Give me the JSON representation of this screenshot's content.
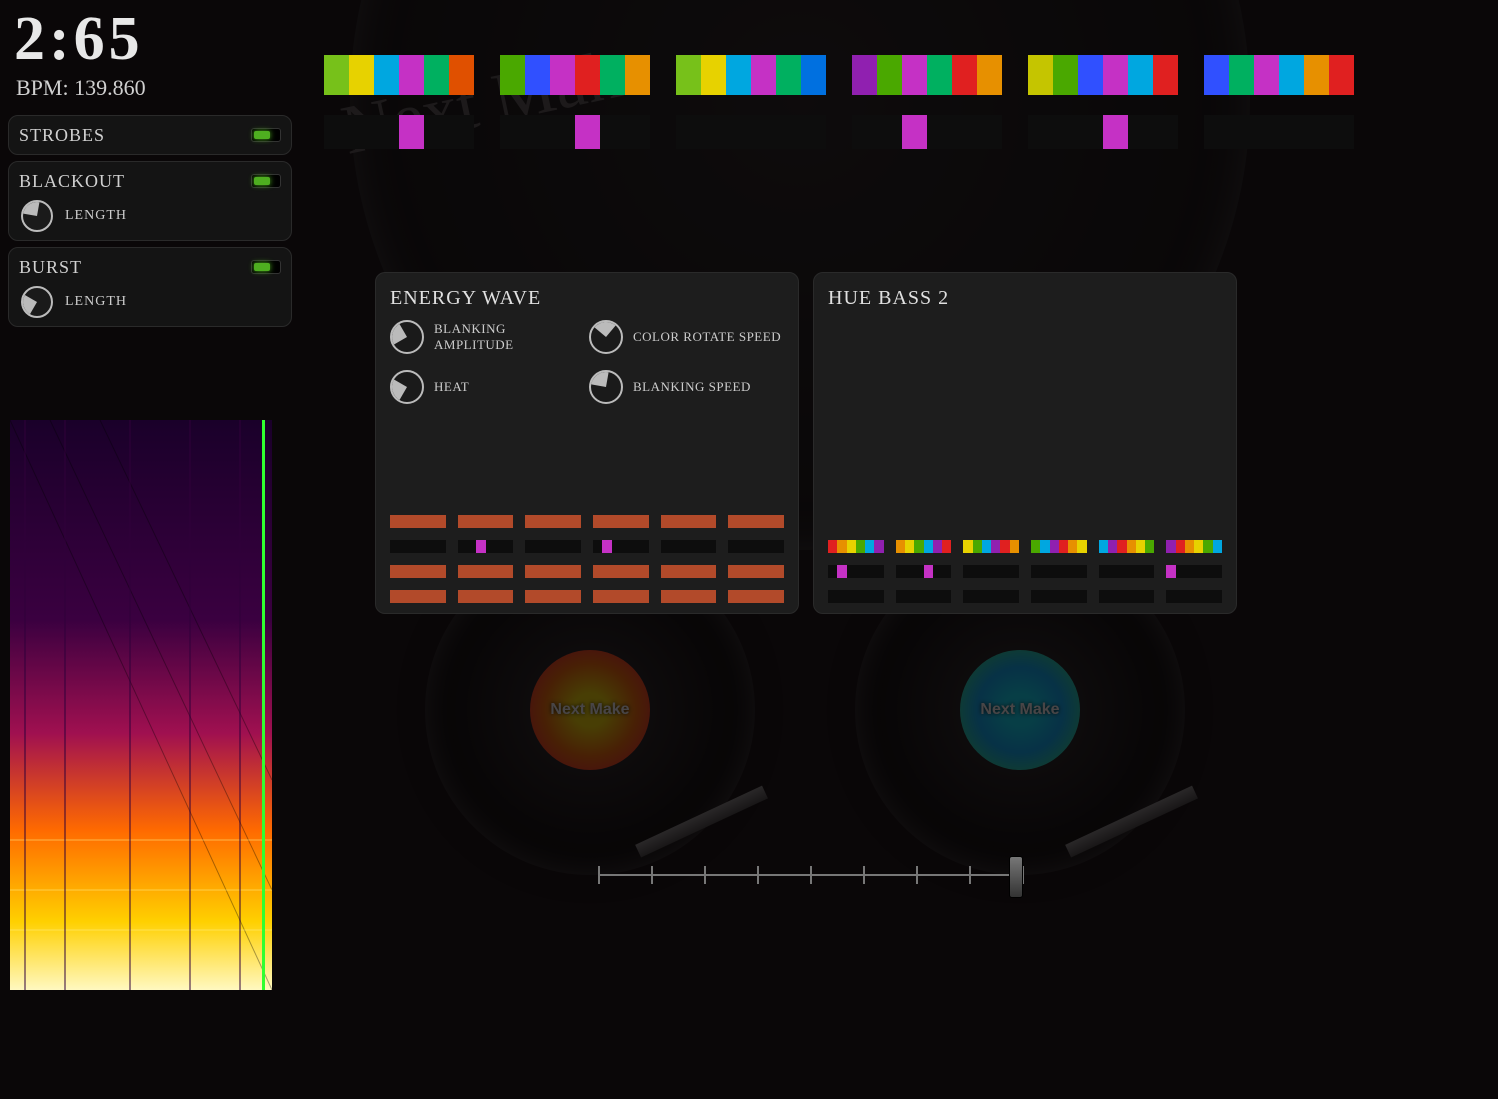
{
  "time": "2:65",
  "bpm_label": "BPM:",
  "bpm_value": "139.860",
  "effects": {
    "strobes": {
      "title": "STROBES",
      "on": true
    },
    "blackout": {
      "title": "BLACKOUT",
      "on": true,
      "length_label": "LENGTH"
    },
    "burst": {
      "title": "BURST",
      "on": true,
      "length_label": "LENGTH"
    }
  },
  "top_strips": [
    [
      "#77c11a",
      "#e7d200",
      "#00a7e0",
      "#c531c5",
      "#00b060",
      "#e05000"
    ],
    [
      "#4aa800",
      "#3050ff",
      "#c531c5",
      "#e02020",
      "#00b060",
      "#e79000"
    ],
    [
      "#77c11a",
      "#e7d200",
      "#00a7e0",
      "#c531c5",
      "#00b060",
      "#0070e0"
    ],
    [
      "#9020b0",
      "#4aa800",
      "#c531c5",
      "#00b060",
      "#e02020",
      "#e79000"
    ],
    [
      "#c5c500",
      "#4aa800",
      "#3050ff",
      "#c531c5",
      "#00a7e0",
      "#e02020"
    ],
    [
      "#3050ff",
      "#00b060",
      "#c531c5",
      "#00a7e0",
      "#e79000",
      "#e02020"
    ]
  ],
  "top_markers": [
    [
      0,
      0,
      0,
      1,
      0,
      0
    ],
    [
      0,
      0,
      0,
      1,
      0,
      0
    ],
    [
      0,
      0,
      0,
      0,
      0,
      0
    ],
    [
      0,
      0,
      1,
      0,
      0,
      0
    ],
    [
      0,
      0,
      0,
      1,
      0,
      0
    ],
    [
      0,
      0,
      0,
      0,
      0,
      0
    ]
  ],
  "decks": {
    "left": {
      "title": "ENERGY WAVE",
      "params": [
        {
          "label": "BLANKING AMPLITUDE",
          "knob": "v330"
        },
        {
          "label": "COLOR ROTATE SPEED",
          "knob": "v40"
        },
        {
          "label": "HEAT",
          "knob": "v300"
        },
        {
          "label": "BLANKING SPEED",
          "knob": "v10"
        }
      ],
      "preview_color": "#b24a2a",
      "preview_rows": 3,
      "preview_markers": [
        [
          0,
          0,
          0,
          0,
          0,
          0
        ],
        [
          0,
          0,
          1,
          0,
          0,
          0
        ],
        [
          0,
          0,
          0,
          0,
          0,
          0
        ],
        [
          0,
          1,
          0,
          0,
          0,
          0
        ],
        [
          0,
          0,
          0,
          0,
          0,
          0
        ],
        [
          0,
          0,
          0,
          0,
          0,
          0
        ]
      ]
    },
    "right": {
      "title": "HUE BASS 2",
      "params": [],
      "preview_rainbow": true,
      "preview_markers_rows": [
        [
          [
            0,
            1,
            0,
            0,
            0,
            0
          ],
          [
            0,
            0,
            0,
            1,
            0,
            0
          ],
          [
            0,
            0,
            0,
            0,
            0,
            0
          ],
          [
            0,
            0,
            0,
            0,
            0,
            0
          ],
          [
            0,
            0,
            0,
            0,
            0,
            0
          ],
          [
            1,
            0,
            0,
            0,
            0,
            0
          ]
        ],
        [
          [
            0,
            0,
            0,
            0,
            0,
            0
          ],
          [
            0,
            0,
            0,
            0,
            0,
            0
          ],
          [
            0,
            0,
            0,
            0,
            0,
            0
          ],
          [
            0,
            0,
            0,
            0,
            0,
            0
          ],
          [
            0,
            0,
            0,
            0,
            0,
            0
          ],
          [
            0,
            0,
            0,
            0,
            0,
            0
          ]
        ]
      ]
    }
  },
  "xfader": {
    "ticks": 9,
    "position": 0.97
  },
  "deco": {
    "record_text": "Next Make"
  }
}
